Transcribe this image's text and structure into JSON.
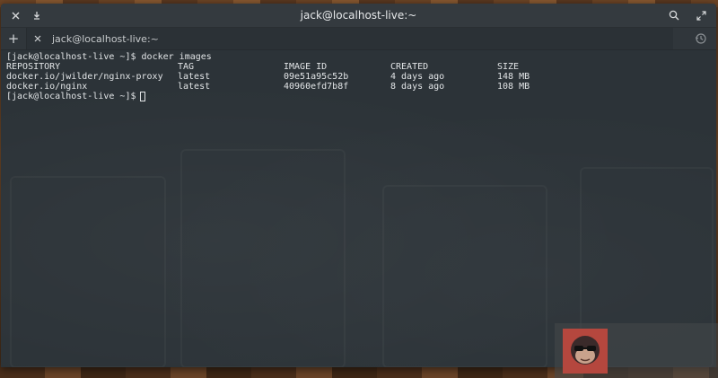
{
  "window": {
    "title": "jack@localhost-live:~"
  },
  "tabs": [
    {
      "label": "jack@localhost-live:~"
    }
  ],
  "terminal": {
    "command_line": {
      "prompt": "[jack@localhost-live ~]$",
      "command": "docker images"
    },
    "table_headers": [
      "REPOSITORY",
      "TAG",
      "IMAGE ID",
      "CREATED",
      "SIZE"
    ],
    "rows": [
      [
        "docker.io/jwilder/nginx-proxy",
        "latest",
        "09e51a95c52b",
        "4 days ago",
        "148 MB"
      ],
      [
        "docker.io/nginx",
        "latest",
        "40960efd7b8f",
        "8 days ago",
        "108 MB"
      ]
    ],
    "current_prompt": "[jack@localhost-live ~]$"
  },
  "icons": {
    "close": "close-icon",
    "download": "download-icon",
    "search": "search-icon",
    "fullscreen": "fullscreen-icon",
    "new_tab": "plus-icon",
    "tab_close": "close-icon",
    "history": "history-icon",
    "avatar": "gorilla-avatar-icon"
  },
  "colors": {
    "terminal_bg": "#2c3338",
    "titlebar_bg": "#343a3f",
    "text": "#e1e4e6"
  }
}
